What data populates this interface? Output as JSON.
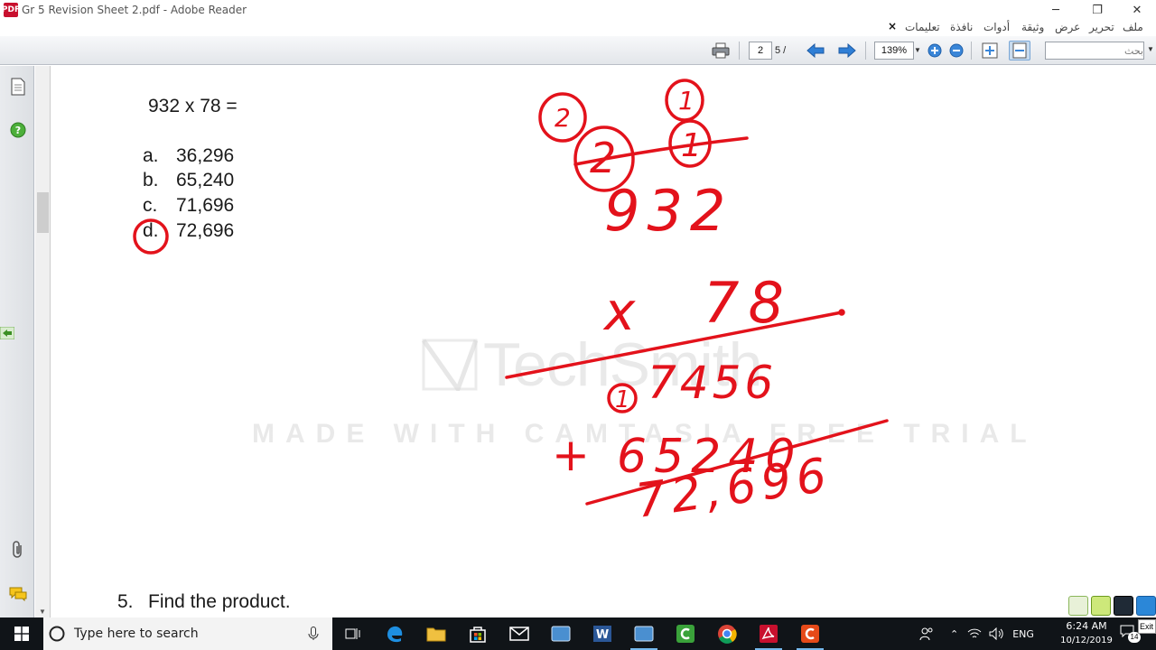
{
  "window": {
    "title": "Gr 5 Revision Sheet 2.pdf - Adobe Reader",
    "app_icon_label": "PDF",
    "minimize_glyph": "─",
    "restore_glyph": "❐",
    "close_glyph": "✕"
  },
  "menu": {
    "items": [
      "ملف",
      "تحرير",
      "عرض",
      "وثيقة",
      "أدوات",
      "نافذة",
      "تعليمات"
    ],
    "close_doc": "×"
  },
  "toolbar": {
    "current_page": "2",
    "total_pages": "5 /",
    "zoom": "139%",
    "search_placeholder": "بحث"
  },
  "document": {
    "problem": "932 x 78 =",
    "options": [
      {
        "letter": "a.",
        "value": "36,296"
      },
      {
        "letter": "b.",
        "value": "65,240"
      },
      {
        "letter": "c.",
        "value": "71,696"
      },
      {
        "letter": "d.",
        "value": "72,696"
      }
    ],
    "circled_option": "d.",
    "next_question_number": "5.",
    "next_question": "Find the product.",
    "work": {
      "carry_top": [
        "2",
        "1"
      ],
      "carry_second": [
        "2",
        "1"
      ],
      "multiplicand": "932",
      "multiplier_sign": "x",
      "multiplier": "78",
      "partial_1_carry": "1",
      "partial_1": "7456",
      "plus": "+",
      "partial_2": "65240",
      "result": "72,696"
    }
  },
  "watermark": {
    "brand": "TechSmith",
    "subtitle": "MADE WITH CAMTASIA FREE TRIAL"
  },
  "taskbar": {
    "search_text": "Type here to search",
    "language": "ENG",
    "time": "6:24 AM",
    "date": "10/12/2019",
    "notification_count": "14",
    "exit_label": "Exit"
  },
  "colors": {
    "ink": "#e3121b",
    "taskbar": "#101418",
    "toolbar": "#e3e6ea"
  }
}
